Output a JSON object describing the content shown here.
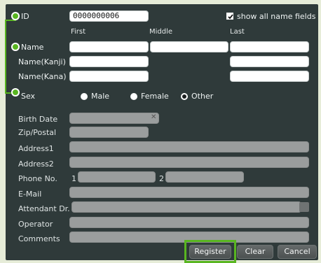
{
  "form": {
    "id_label": "ID",
    "id_value": "0000000006",
    "show_all_label": "show all name fields",
    "show_all_checked": true,
    "col_first": "First",
    "col_middle": "Middle",
    "col_last": "Last",
    "name_label": "Name",
    "name_kanji_label": "Name(Kanji)",
    "name_kana_label": "Name(Kana)",
    "sex_label": "Sex",
    "sex_options": [
      "Male",
      "Female",
      "Other"
    ],
    "sex_selected": "Other",
    "birth_label": "Birth Date",
    "zip_label": "Zip/Postal",
    "address1_label": "Address1",
    "address2_label": "Address2",
    "phone_label": "Phone No.",
    "phone1_prefix": "1",
    "phone2_prefix": "2",
    "email_label": "E-Mail",
    "attendant_label": "Attendant Dr.",
    "operator_label": "Operator",
    "comments_label": "Comments"
  },
  "buttons": {
    "register": "Register",
    "clear": "Clear",
    "cancel": "Cancel"
  },
  "colors": {
    "panel": "#2f3a3a",
    "highlight": "#58b520",
    "field_disabled": "#9a9d9d"
  }
}
